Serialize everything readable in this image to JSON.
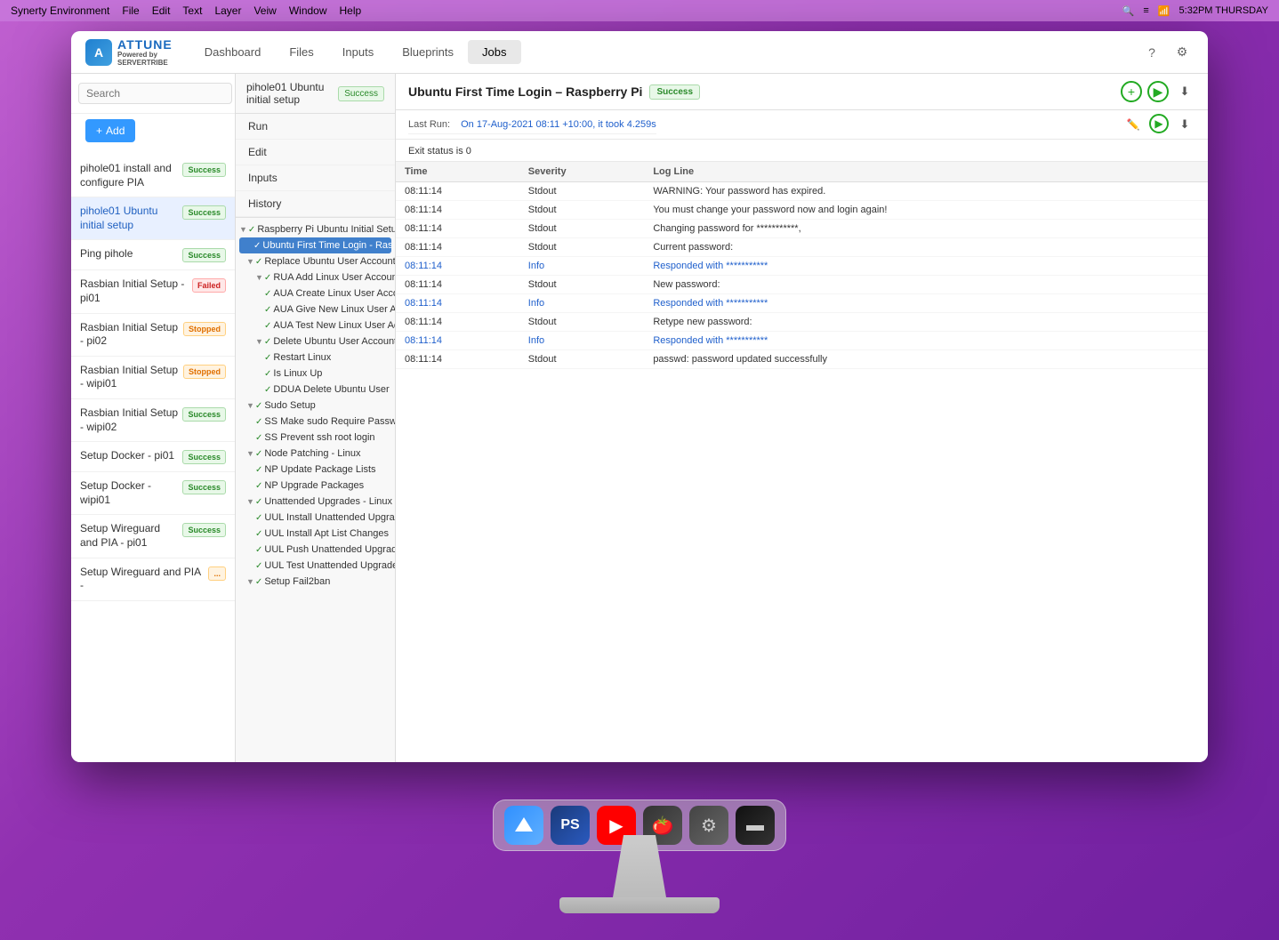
{
  "menubar": {
    "app_name": "Synerty Environment",
    "menus": [
      "File",
      "Edit",
      "Text",
      "Layer",
      "Veiw",
      "Window",
      "Help"
    ],
    "time": "5:32PM THURSDAY"
  },
  "app": {
    "logo_text": "ATTUNE",
    "powered_by": "Powered by",
    "powered_by_brand": "SERVERTRIBE",
    "nav_tabs": [
      "Dashboard",
      "Files",
      "Inputs",
      "Blueprints",
      "Jobs"
    ],
    "active_tab": "Jobs"
  },
  "sidebar": {
    "search_placeholder": "Search",
    "add_label": "+ Add",
    "items": [
      {
        "name": "pihole01 install and configure PIA",
        "status": "Success",
        "status_type": "success"
      },
      {
        "name": "pihole01 Ubuntu initial setup",
        "status": "Success",
        "status_type": "success",
        "active": true
      },
      {
        "name": "Ping pihole",
        "status": "Success",
        "status_type": "success"
      },
      {
        "name": "Rasbian Initial Setup - pi01",
        "status": "Failed",
        "status_type": "failed"
      },
      {
        "name": "Rasbian Initial Setup - pi02",
        "status": "Stopped",
        "status_type": "stopped"
      },
      {
        "name": "Rasbian Initial Setup - wipi01",
        "status": "Stopped",
        "status_type": "stopped"
      },
      {
        "name": "Rasbian Initial Setup - wipi02",
        "status": "Success",
        "status_type": "success"
      },
      {
        "name": "Setup Docker - pi01",
        "status": "Success",
        "status_type": "success"
      },
      {
        "name": "Setup Docker - wipi01",
        "status": "Success",
        "status_type": "success"
      },
      {
        "name": "Setup Wireguard and PIA - pi01",
        "status": "Success",
        "status_type": "success"
      },
      {
        "name": "Setup Wireguard and PIA -",
        "status": "...",
        "status_type": "stopped"
      }
    ]
  },
  "job_panel": {
    "breadcrumb": "pihole01 Ubuntu initial setup",
    "breadcrumb_status": "Success",
    "actions": [
      "Run",
      "Edit",
      "Inputs",
      "History"
    ],
    "tree": [
      {
        "label": "Raspberry Pi Ubuntu Initial Setup",
        "level": 0,
        "type": "group",
        "collapsed": false,
        "check": true
      },
      {
        "label": "Ubuntu First Time Login - Raspberry Pi",
        "level": 1,
        "type": "item",
        "check": true,
        "selected": true
      },
      {
        "label": "Replace Ubuntu User Account",
        "level": 1,
        "type": "group",
        "collapsed": false,
        "check": true
      },
      {
        "label": "RUA Add Linux User Account",
        "level": 2,
        "type": "group",
        "collapsed": false,
        "check": true
      },
      {
        "label": "AUA Create Linux User Account",
        "level": 3,
        "type": "item",
        "check": true
      },
      {
        "label": "AUA Give New Linux User Account sudo Privilege",
        "level": 3,
        "type": "item",
        "check": true
      },
      {
        "label": "AUA Test New Linux User Account",
        "level": 3,
        "type": "item",
        "check": true
      },
      {
        "label": "Delete Ubuntu User Account - Linux",
        "level": 2,
        "type": "group",
        "collapsed": false,
        "check": true
      },
      {
        "label": "Restart Linux",
        "level": 3,
        "type": "item",
        "check": true
      },
      {
        "label": "Is Linux Up",
        "level": 3,
        "type": "item",
        "check": true
      },
      {
        "label": "DDUA Delete Ubuntu User",
        "level": 3,
        "type": "item",
        "check": true
      },
      {
        "label": "Sudo Setup",
        "level": 1,
        "type": "group",
        "collapsed": false,
        "check": true
      },
      {
        "label": "SS Make sudo Require Password",
        "level": 2,
        "type": "item",
        "check": true
      },
      {
        "label": "SS Prevent ssh root login",
        "level": 2,
        "type": "item",
        "check": true
      },
      {
        "label": "Node Patching - Linux",
        "level": 1,
        "type": "group",
        "collapsed": false,
        "check": true
      },
      {
        "label": "NP Update Package Lists",
        "level": 2,
        "type": "item",
        "check": true
      },
      {
        "label": "NP Upgrade Packages",
        "level": 2,
        "type": "item",
        "check": true
      },
      {
        "label": "Unattended Upgrades - Linux",
        "level": 1,
        "type": "group",
        "collapsed": false,
        "check": true
      },
      {
        "label": "UUL Install Unattended Upgrades Package",
        "level": 2,
        "type": "item",
        "check": true
      },
      {
        "label": "UUL Install Apt List Changes",
        "level": 2,
        "type": "item",
        "check": true
      },
      {
        "label": "UUL Push Unattended Upgrades Config",
        "level": 2,
        "type": "item",
        "check": true
      },
      {
        "label": "UUL Test Unattended Upgrade",
        "level": 2,
        "type": "item",
        "check": true
      },
      {
        "label": "Setup Fail2ban",
        "level": 1,
        "type": "group",
        "collapsed": false,
        "check": true
      }
    ]
  },
  "detail_panel": {
    "title": "Ubuntu First Time Login – Raspberry Pi",
    "status": "Success",
    "last_run_label": "Last Run:",
    "last_run_value": "On 17-Aug-2021 08:11 +10:00, it took 4.259s",
    "exit_status": "Exit status is 0",
    "columns": [
      "Time",
      "Severity",
      "Log Line"
    ],
    "log_rows": [
      {
        "time": "08:11:14",
        "time_link": false,
        "severity": "Stdout",
        "line": "WARNING: Your password has expired."
      },
      {
        "time": "08:11:14",
        "time_link": false,
        "severity": "Stdout",
        "line": "You must change your password now and login again!"
      },
      {
        "time": "08:11:14",
        "time_link": false,
        "severity": "Stdout",
        "line": "Changing password for ***********,"
      },
      {
        "time": "08:11:14",
        "time_link": false,
        "severity": "Stdout",
        "line": "Current password:"
      },
      {
        "time": "08:11:14",
        "time_link": true,
        "severity": "Info",
        "line": "Responded with ***********",
        "line_link": true
      },
      {
        "time": "08:11:14",
        "time_link": false,
        "severity": "Stdout",
        "line": "New password:"
      },
      {
        "time": "08:11:14",
        "time_link": true,
        "severity": "Info",
        "line": "Responded with ***********",
        "line_link": true
      },
      {
        "time": "08:11:14",
        "time_link": false,
        "severity": "Stdout",
        "line": "Retype new password:"
      },
      {
        "time": "08:11:14",
        "time_link": true,
        "severity": "Info",
        "line": "Responded with ***********",
        "line_link": true
      },
      {
        "time": "08:11:14",
        "time_link": false,
        "severity": "Stdout",
        "line": "passwd: password updated successfully"
      }
    ]
  },
  "dock": {
    "icons": [
      {
        "name": "attune-icon",
        "label": "Attune"
      },
      {
        "name": "powershell-icon",
        "label": "PowerShell"
      },
      {
        "name": "youtube-icon",
        "label": "YouTube"
      },
      {
        "name": "pomodoro-icon",
        "label": "Pomodoro"
      },
      {
        "name": "settings-icon",
        "label": "Settings"
      },
      {
        "name": "terminal-icon",
        "label": "Terminal"
      }
    ]
  }
}
